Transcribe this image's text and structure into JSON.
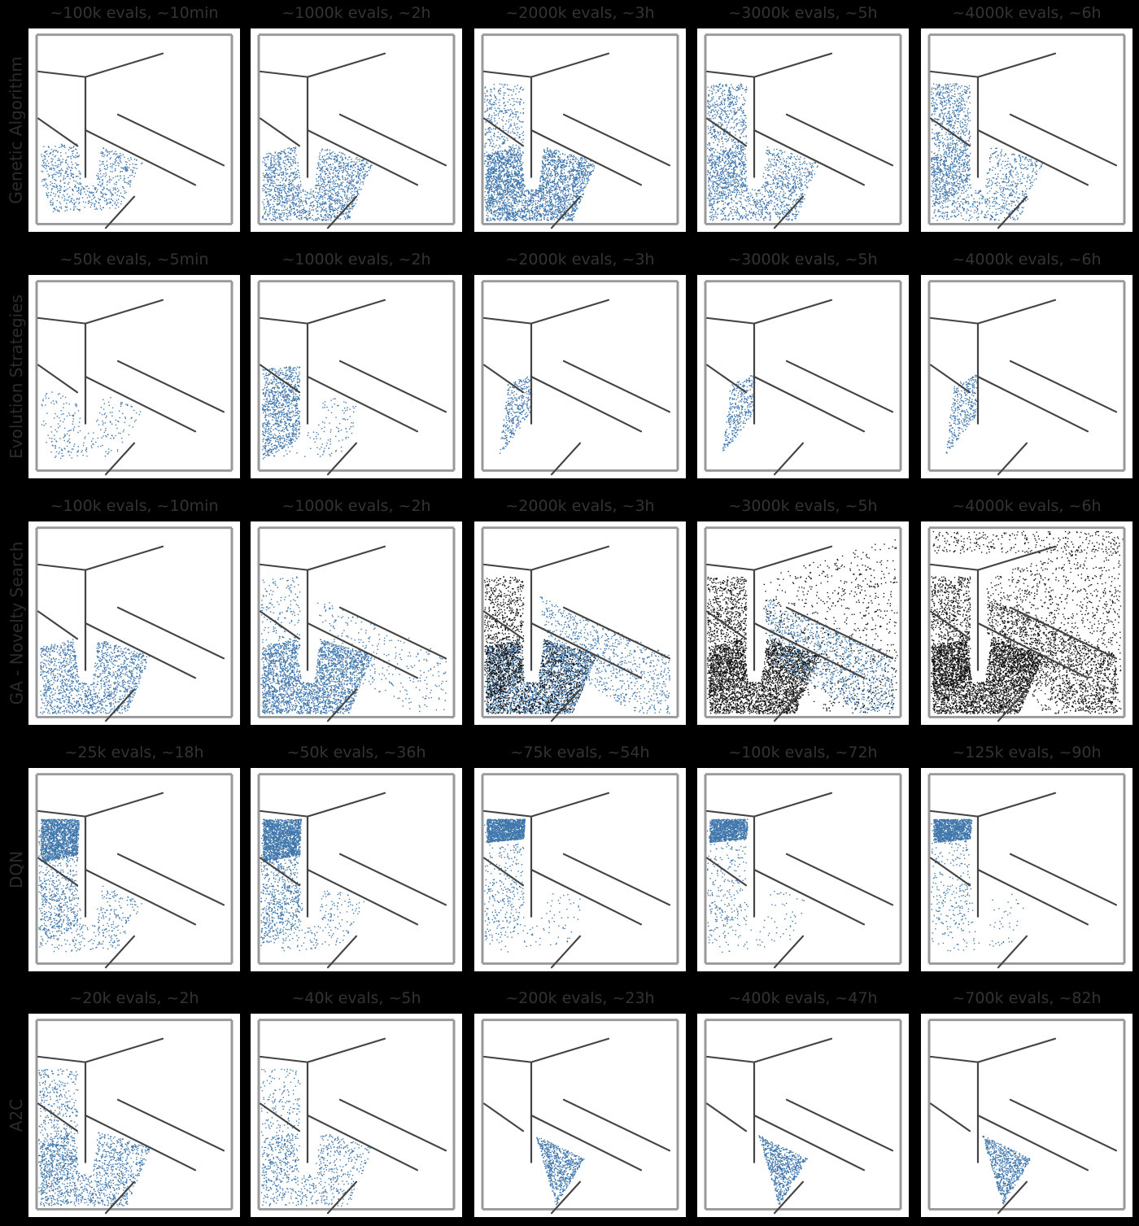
{
  "colors": {
    "background": "#000000",
    "panel": "#ffffff",
    "wall": "#444444",
    "border": "#999999",
    "trail": "#3f76ab",
    "dense": "#111111"
  },
  "rows": [
    {
      "label": "Genetic Algorithm",
      "panels": [
        {
          "title": "~100k evals, ~10min",
          "coverage": "ga1"
        },
        {
          "title": "~1000k evals, ~2h",
          "coverage": "ga2"
        },
        {
          "title": "~2000k evals, ~3h",
          "coverage": "ga3"
        },
        {
          "title": "~3000k evals, ~5h",
          "coverage": "ga4"
        },
        {
          "title": "~4000k evals, ~6h",
          "coverage": "ga5"
        }
      ]
    },
    {
      "label": "Evolution Strategies",
      "panels": [
        {
          "title": "~50k evals, ~5min",
          "coverage": "es1"
        },
        {
          "title": "~1000k evals, ~2h",
          "coverage": "es2"
        },
        {
          "title": "~2000k evals, ~3h",
          "coverage": "es3"
        },
        {
          "title": "~3000k evals, ~5h",
          "coverage": "es3"
        },
        {
          "title": "~4000k evals, ~6h",
          "coverage": "es3"
        }
      ]
    },
    {
      "label": "GA - Novelty Search",
      "panels": [
        {
          "title": "~100k evals, ~10min",
          "coverage": "ns1"
        },
        {
          "title": "~1000k evals, ~2h",
          "coverage": "ns2"
        },
        {
          "title": "~2000k evals, ~3h",
          "coverage": "ns3"
        },
        {
          "title": "~3000k evals, ~5h",
          "coverage": "ns4"
        },
        {
          "title": "~4000k evals, ~6h",
          "coverage": "ns5"
        }
      ]
    },
    {
      "label": "DQN",
      "panels": [
        {
          "title": "~25k evals, ~18h",
          "coverage": "dqn1"
        },
        {
          "title": "~50k evals, ~36h",
          "coverage": "dqn2"
        },
        {
          "title": "~75k evals, ~54h",
          "coverage": "dqn3"
        },
        {
          "title": "~100k evals, ~72h",
          "coverage": "dqn4"
        },
        {
          "title": "~125k evals, ~90h",
          "coverage": "dqn4"
        }
      ]
    },
    {
      "label": "A2C",
      "panels": [
        {
          "title": "~20k evals, ~2h",
          "coverage": "a2c1"
        },
        {
          "title": "~40k evals, ~5h",
          "coverage": "a2c2"
        },
        {
          "title": "~200k evals, ~23h",
          "coverage": "a2c3"
        },
        {
          "title": "~400k evals, ~47h",
          "coverage": "a2c3"
        },
        {
          "title": "~700k evals, ~82h",
          "coverage": "a2c3"
        }
      ]
    }
  ]
}
